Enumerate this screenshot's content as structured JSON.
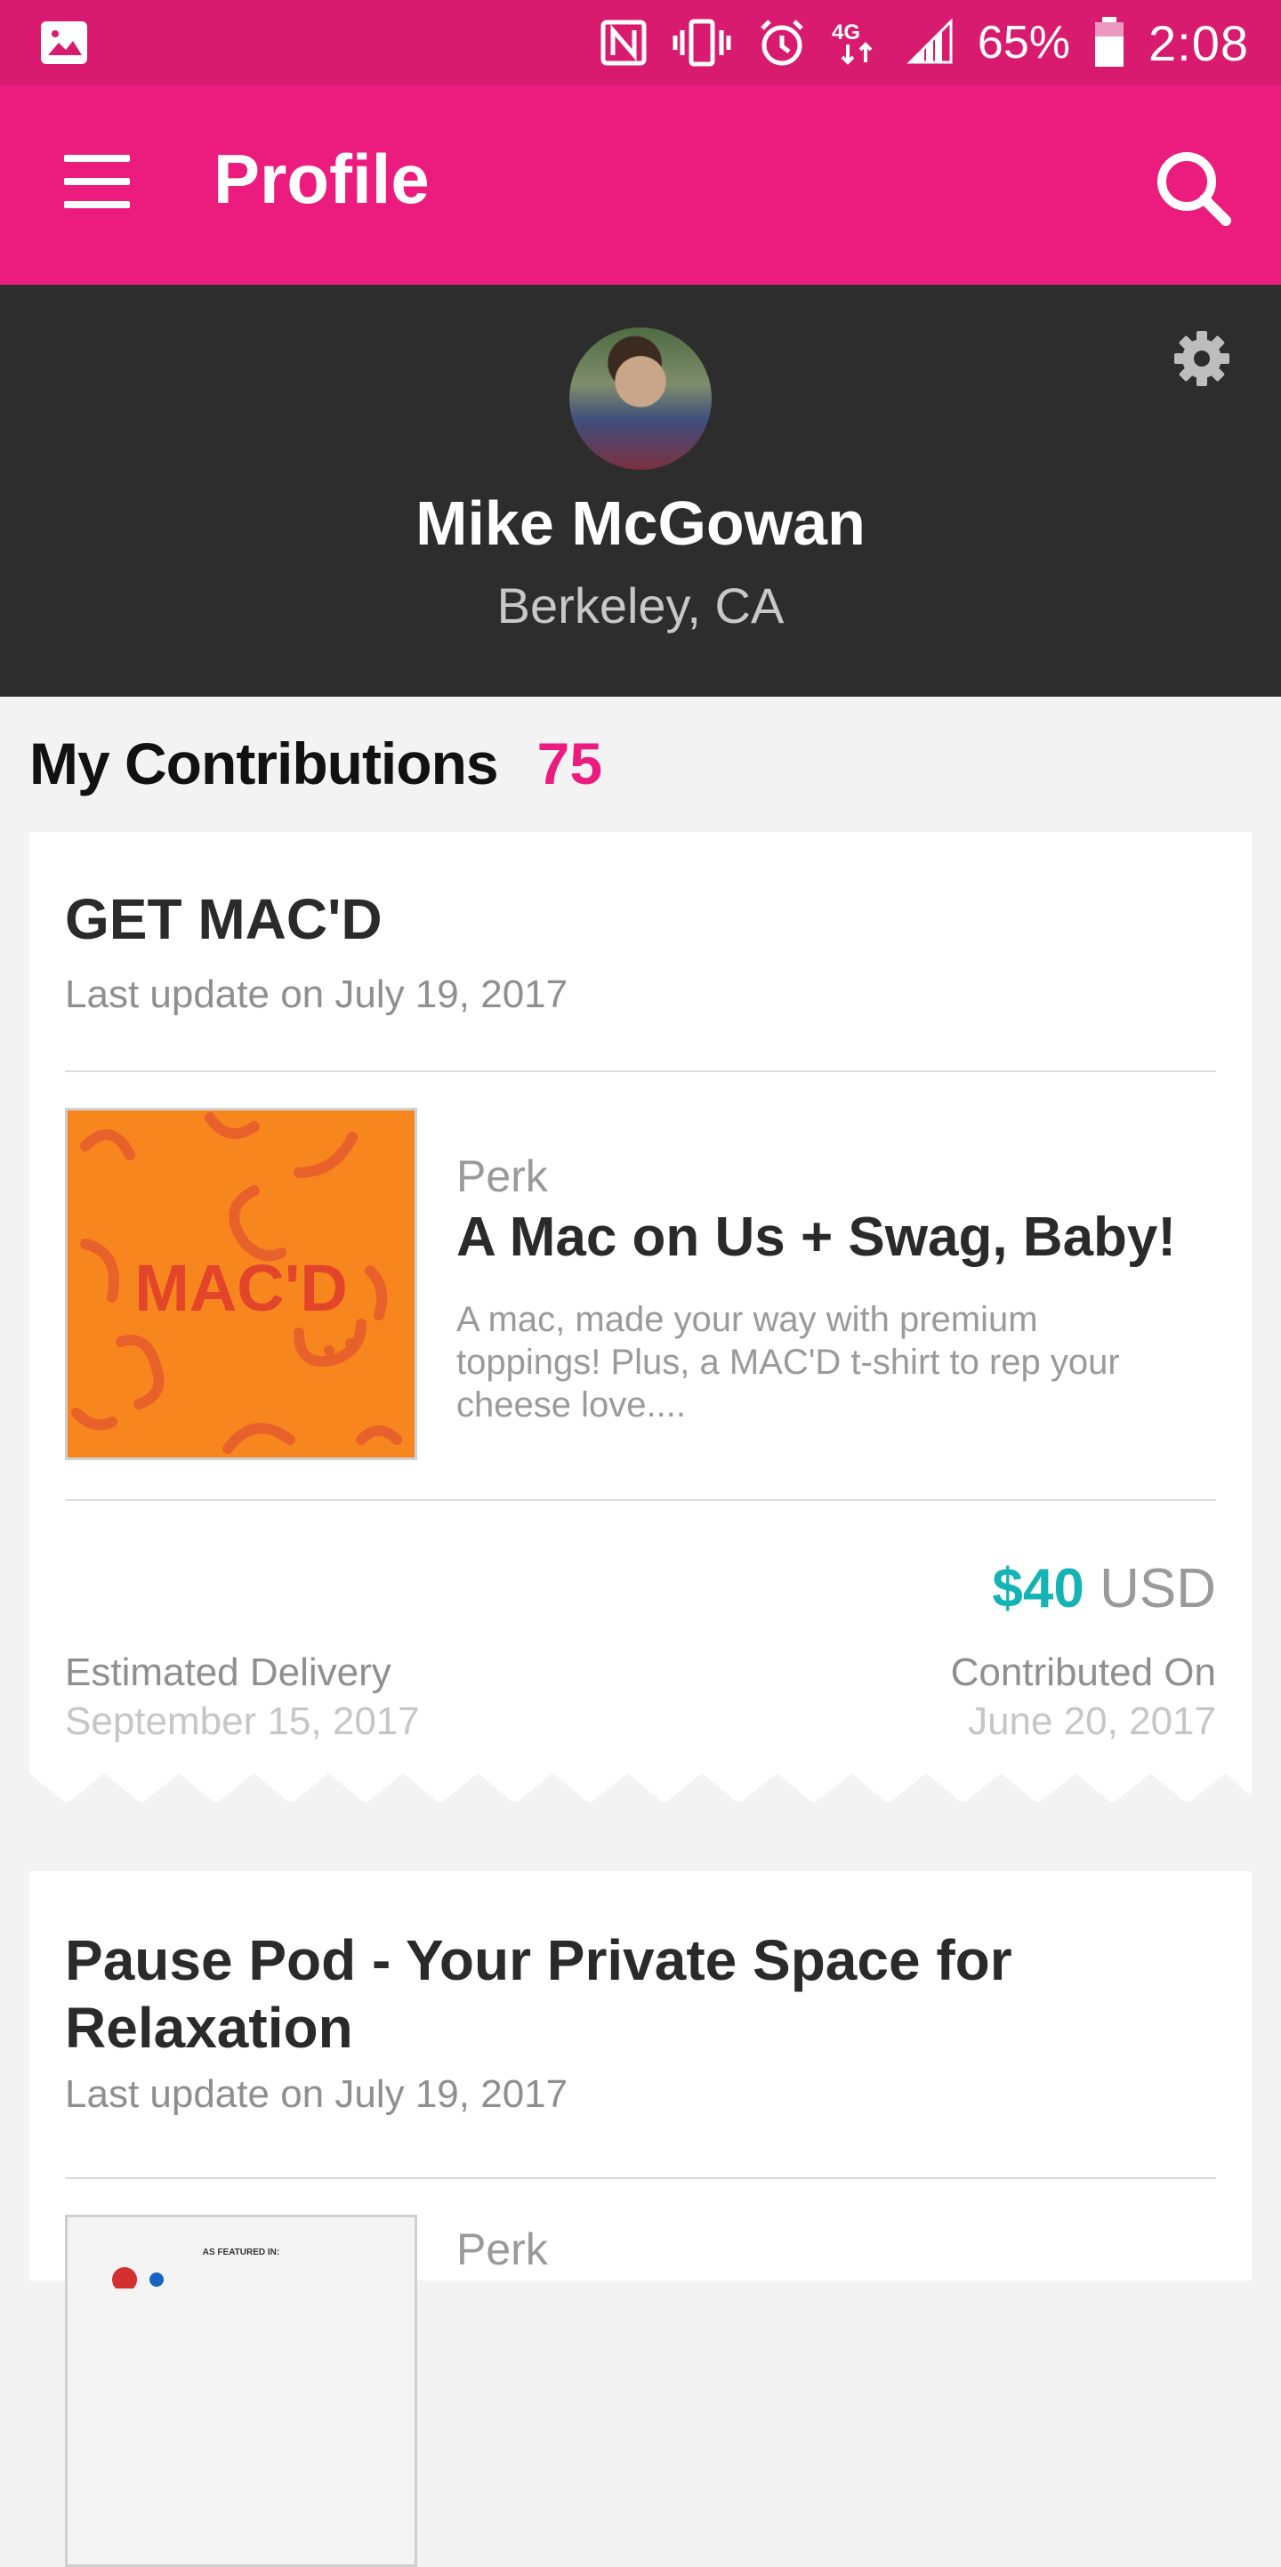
{
  "status_bar": {
    "battery": "65%",
    "time": "2:08",
    "network": "4G"
  },
  "app_bar": {
    "title": "Profile"
  },
  "profile": {
    "name": "Mike McGowan",
    "location": "Berkeley, CA"
  },
  "contributions": {
    "title": "My Contributions",
    "count": "75",
    "items": [
      {
        "title": "GET MAC'D",
        "last_update": "Last update on July 19, 2017",
        "perk_label": "Perk",
        "perk_title": "A Mac on Us + Swag, Baby!",
        "perk_desc": "A mac, made your way with premium toppings! Plus, a MAC'D t-shirt to rep your cheese love....",
        "perk_image_text": "MAC'D",
        "amount": "$40",
        "currency": "USD",
        "delivery_label": "Estimated Delivery",
        "delivery_value": "September 15, 2017",
        "contributed_label": "Contributed On",
        "contributed_value": "June 20, 2017"
      },
      {
        "title": "Pause Pod - Your Private Space for Relaxation",
        "last_update": "Last update on July 19, 2017",
        "perk_label": "Perk",
        "perk_image_text": "AS FEATURED IN:"
      }
    ]
  },
  "colors": {
    "status_bar": "#d81b6f",
    "app_bar": "#ec1b7e",
    "profile_bg": "#2d2d2d",
    "accent_amount": "#14b3b4"
  }
}
